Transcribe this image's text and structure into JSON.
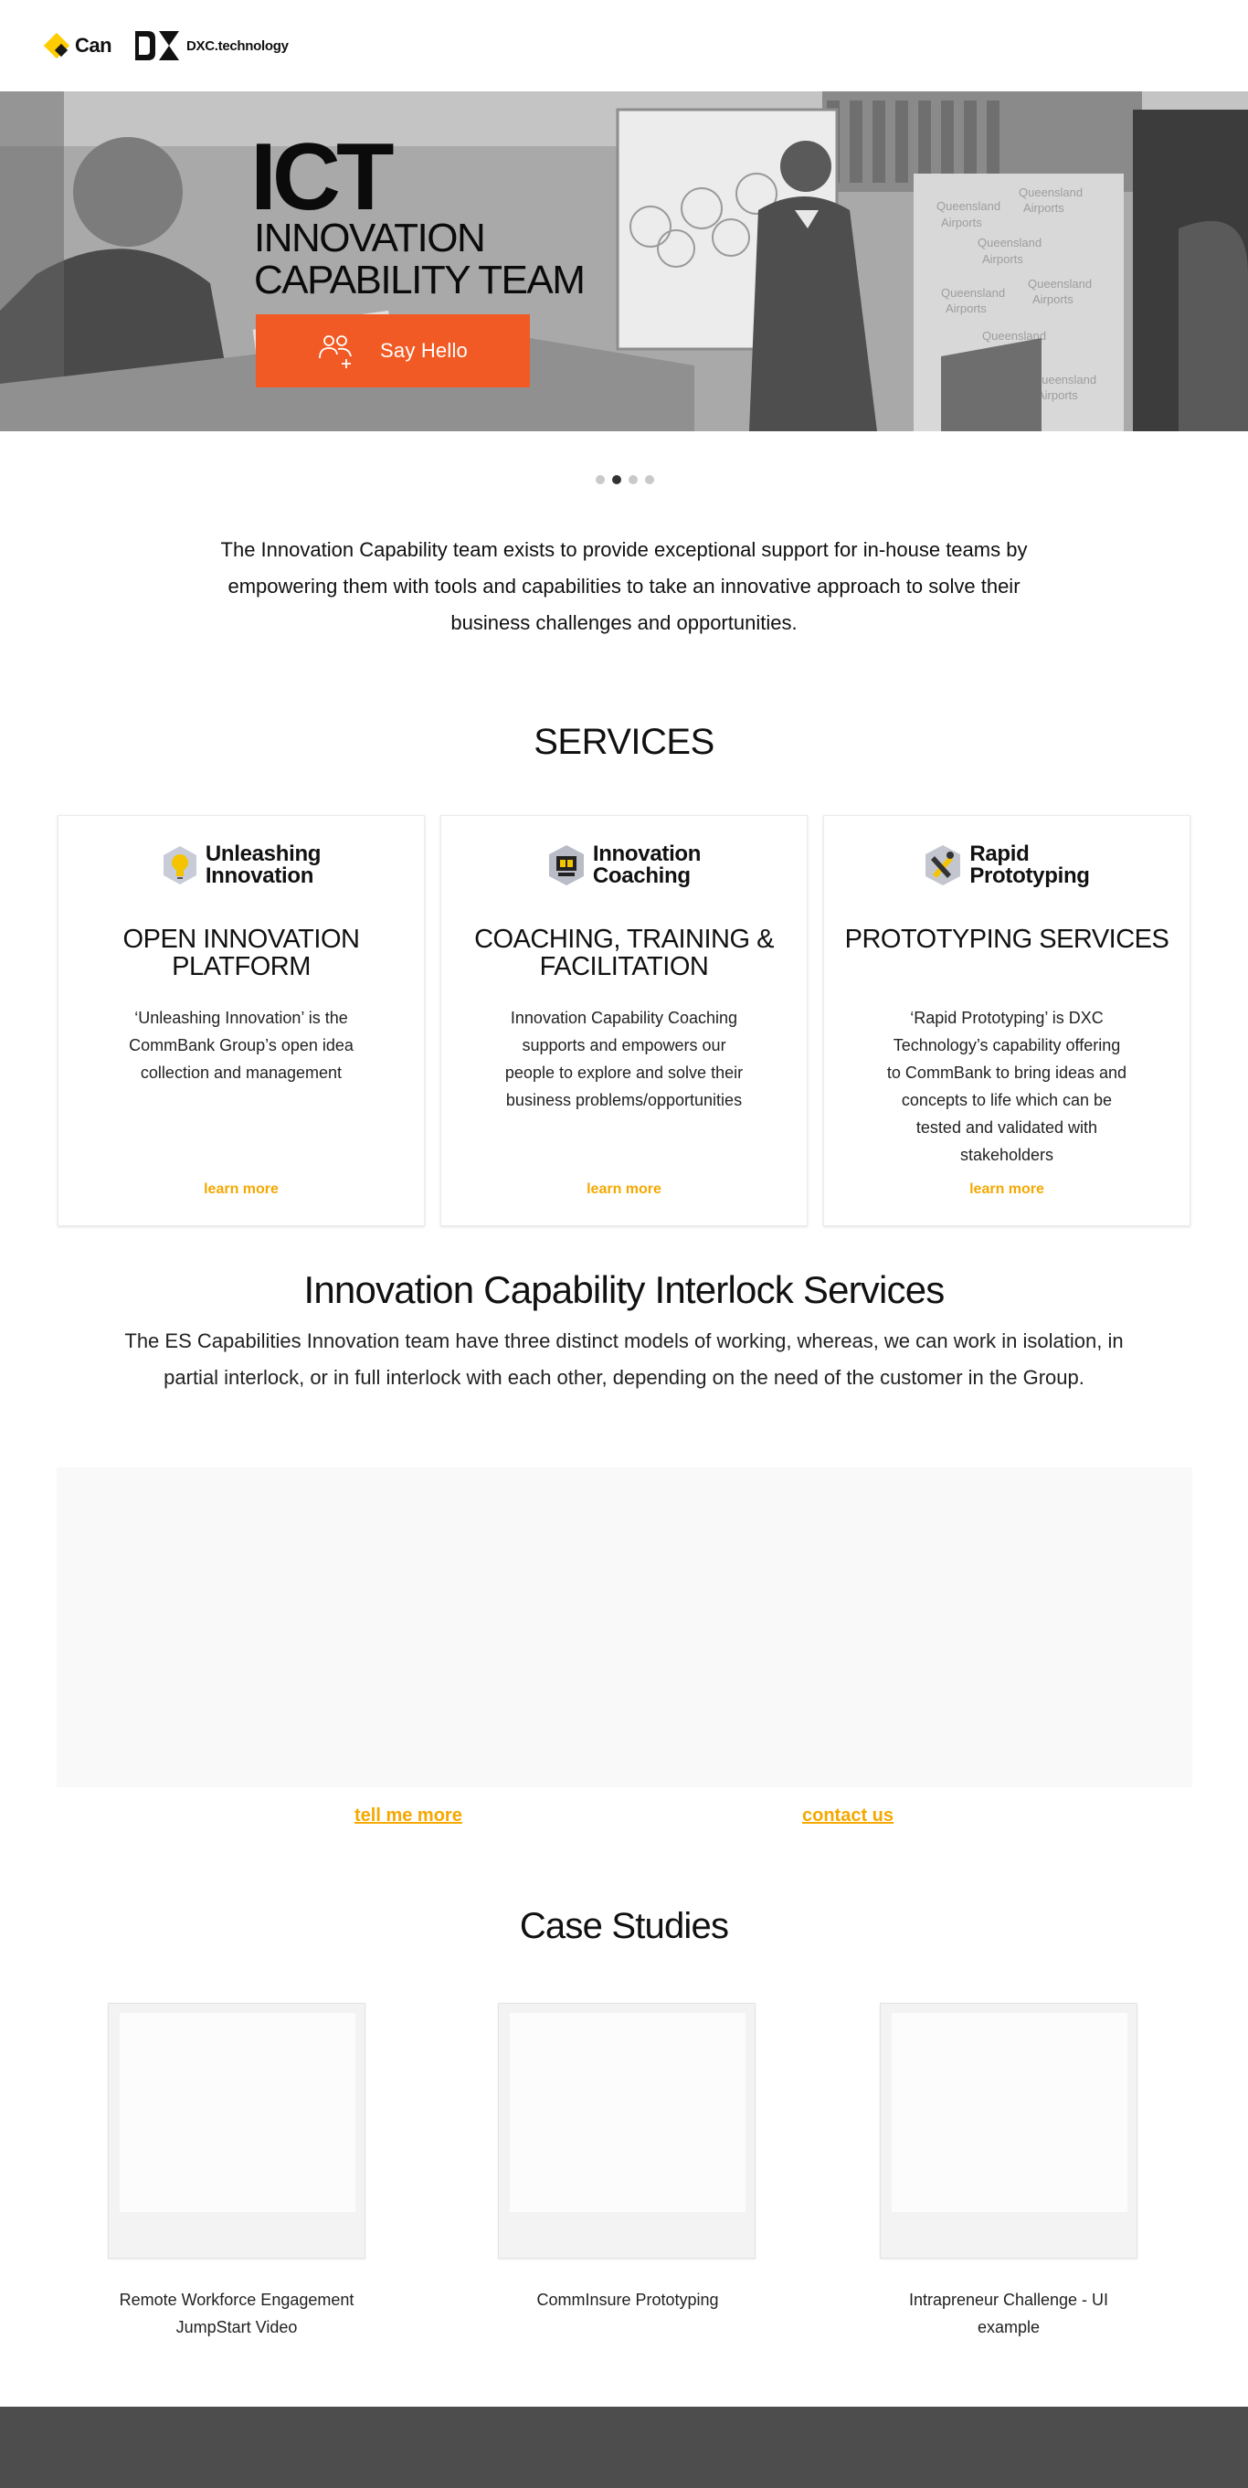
{
  "header": {
    "brand_can": "Can",
    "brand_dxc": "DXC.technology"
  },
  "hero": {
    "title": "ICT",
    "subtitle_line1": "INNOVATION",
    "subtitle_line2": "CAPABILITY TEAM",
    "cta_label": "Say Hello",
    "cta_icon": "add-people-icon",
    "accent_color": "#f15a24"
  },
  "carousel": {
    "slide_count": 4,
    "active_index": 1
  },
  "intro": {
    "text": "The Innovation Capability team exists to provide exceptional support for in-house teams by empowering them with tools and capabilities to take an innovative approach to solve their business challenges and opportunities."
  },
  "services": {
    "heading": "SERVICES",
    "cards": [
      {
        "logo_line1": "Unleashing",
        "logo_line2": "Innovation",
        "logo_icon": "lightbulb-icon",
        "title": "OPEN INNOVATION PLATFORM",
        "text": "‘Unleashing Innovation’ is the CommBank Group’s open idea collection and management",
        "link": "learn more"
      },
      {
        "logo_line1": "Innovation",
        "logo_line2": "Coaching",
        "logo_icon": "coaching-icon",
        "title": "COACHING, TRAINING & FACILITATION",
        "text": "Innovation Capability Coaching supports and empowers our people to explore and solve their business problems/opportunities",
        "link": "learn more"
      },
      {
        "logo_line1": "Rapid",
        "logo_line2": "Prototyping",
        "logo_icon": "tools-icon",
        "title": "PROTOTYPING SERVICES",
        "text": "‘Rapid Prototyping’ is DXC Technology’s capability offering to CommBank to bring ideas and concepts to life which can be tested and validated with stakeholders",
        "link": "learn more"
      }
    ],
    "link_color": "#f5a800"
  },
  "interlock": {
    "heading": "Innovation Capability Interlock Services",
    "text": "The ES Capabilities Innovation team have three distinct models of working, whereas, we can work in isolation, in partial interlock, or in full interlock with each other, depending on the need of the customer in the Group.",
    "tell_me_more": "tell me more",
    "contact_us": "contact us"
  },
  "case_studies": {
    "heading": "Case Studies",
    "items": [
      {
        "label": "Remote Workforce Engagement JumpStart Video"
      },
      {
        "label": "CommInsure Prototyping"
      },
      {
        "label": "Intrapreneur Challenge - UI example"
      }
    ]
  }
}
